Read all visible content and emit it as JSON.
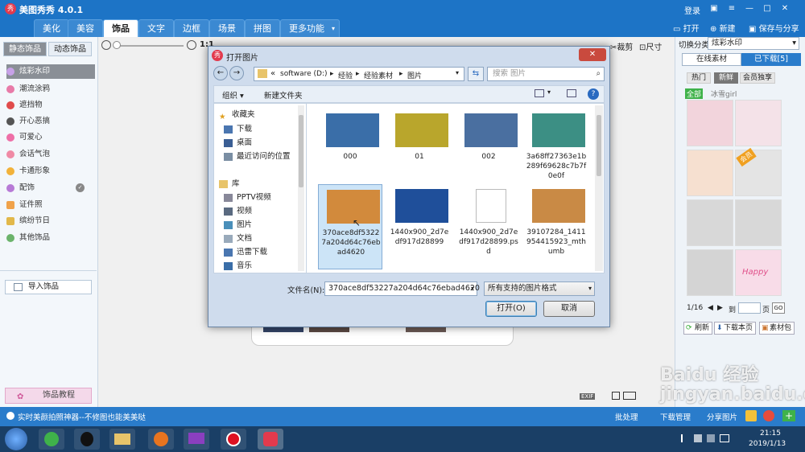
{
  "app": {
    "title": "美图秀秀 4.0.1",
    "logo_text": "秀",
    "login": "登录"
  },
  "tabs": [
    "美化",
    "美容",
    "饰品",
    "文字",
    "边框",
    "场景",
    "拼图",
    "更多功能"
  ],
  "toolbar": {
    "open": "打开",
    "new": "新建",
    "save": "保存与分享",
    "crop": "裁剪",
    "size": "尺寸",
    "ratio": "1:1"
  },
  "left_panel": {
    "tab_static": "静态饰品",
    "tab_dynamic": "动态饰品",
    "items": [
      "炫彩水印",
      "潮流涂鸦",
      "遮挡物",
      "开心恶搞",
      "可爱心",
      "会话气泡",
      "卡通形象",
      "配饰",
      "证件照",
      "缤纷节日",
      "其他饰品"
    ],
    "import": "导入饰品",
    "tutorial": "饰品教程"
  },
  "right_panel": {
    "switch_label": "切换分类",
    "category": "炫彩水印",
    "tab_online": "在线素材",
    "tab_downloaded": "已下载[5]",
    "filters": [
      "热门",
      "新鲜",
      "会员独享"
    ],
    "all": "全部",
    "author": "冰雪girl",
    "badge": "会员",
    "happy": "Happy",
    "page": "1/16",
    "goto_pre": "到",
    "goto_post": "页",
    "go": "GO",
    "refresh": "刷新",
    "download_page": "下载本页",
    "material_pack": "素材包"
  },
  "status": {
    "tip": "实时美颜拍照神器--不修图也能美美哒",
    "batch": "批处理",
    "download_mgr": "下载管理",
    "share": "分享图片",
    "exif": "EXIF"
  },
  "dialog": {
    "title": "打开图片",
    "path": [
      "software (D:)",
      "经验",
      "经验素材",
      "图片"
    ],
    "search_placeholder": "搜索 图片",
    "organize": "组织 ▾",
    "new_folder": "新建文件夹",
    "nav": {
      "favorites": "收藏夹",
      "fav_items": [
        "下载",
        "桌面",
        "最近访问的位置"
      ],
      "library": "库",
      "lib_items": [
        "PPTV视频",
        "视频",
        "图片",
        "文档",
        "迅雷下载",
        "音乐"
      ]
    },
    "files": [
      {
        "name": "000",
        "color": "#3a6ea8"
      },
      {
        "name": "01",
        "color": "#b9a62c"
      },
      {
        "name": "002",
        "color": "#4a6fa0"
      },
      {
        "name": "3a68ff27363e1b289f69628c7b7f0e0f",
        "color": "#3c8f84"
      },
      {
        "name": "370ace8df53227a204d64c76ebad4620",
        "color": "#d28a3c"
      },
      {
        "name": "1440x900_2d7edf917d28899",
        "color": "#1f4f9a"
      },
      {
        "name": "1440x900_2d7edf917d28899.psd",
        "color": "#ffffff"
      },
      {
        "name": "39107284_1411954415923_mthumb",
        "color": "#c98a45"
      }
    ],
    "filename_label": "文件名(N):",
    "filename_value": "370ace8df53227a204d64c76ebad4620",
    "filetype": "所有支持的图片格式",
    "open_button": "打开(O)",
    "cancel_button": "取消"
  },
  "taskbar": {
    "time": "21:15",
    "date": "2019/1/13"
  },
  "watermark": "Baidu 经验\njingyan.baidu.com"
}
